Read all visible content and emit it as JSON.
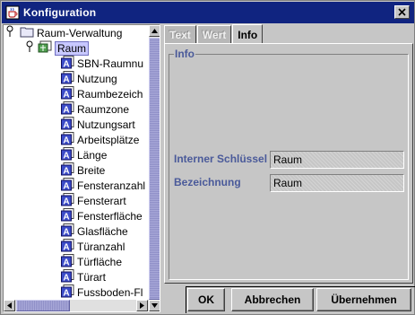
{
  "window": {
    "title": "Konfiguration"
  },
  "tree": {
    "root": {
      "label": "Raum-Verwaltung"
    },
    "selected": {
      "label": "Raum"
    },
    "items": [
      {
        "label": "SBN-Raumnu"
      },
      {
        "label": "Nutzung"
      },
      {
        "label": "Raumbezeich"
      },
      {
        "label": "Raumzone"
      },
      {
        "label": "Nutzungsart"
      },
      {
        "label": "Arbeitsplätze"
      },
      {
        "label": "Länge"
      },
      {
        "label": "Breite"
      },
      {
        "label": "Fensteranzahl"
      },
      {
        "label": "Fensterart"
      },
      {
        "label": "Fensterfläche"
      },
      {
        "label": "Glasfläche"
      },
      {
        "label": "Türanzahl"
      },
      {
        "label": "Türfläche"
      },
      {
        "label": "Türart"
      },
      {
        "label": "Fussboden-Fl"
      }
    ]
  },
  "tabs": [
    {
      "label": "Text",
      "state": "disabled"
    },
    {
      "label": "Wert",
      "state": "disabled"
    },
    {
      "label": "Info",
      "state": "active"
    }
  ],
  "info": {
    "group_title": "Info",
    "fields": [
      {
        "label": "Interner Schlüssel",
        "value": "Raum"
      },
      {
        "label": "Bezeichnung",
        "value": "Raum"
      }
    ]
  },
  "buttons": {
    "ok": "OK",
    "cancel": "Abbrechen",
    "apply": "Übernehmen"
  },
  "colors": {
    "titlebar": "#102480",
    "label_blue": "#4a5a9a",
    "selection": "#c8c8ff"
  }
}
